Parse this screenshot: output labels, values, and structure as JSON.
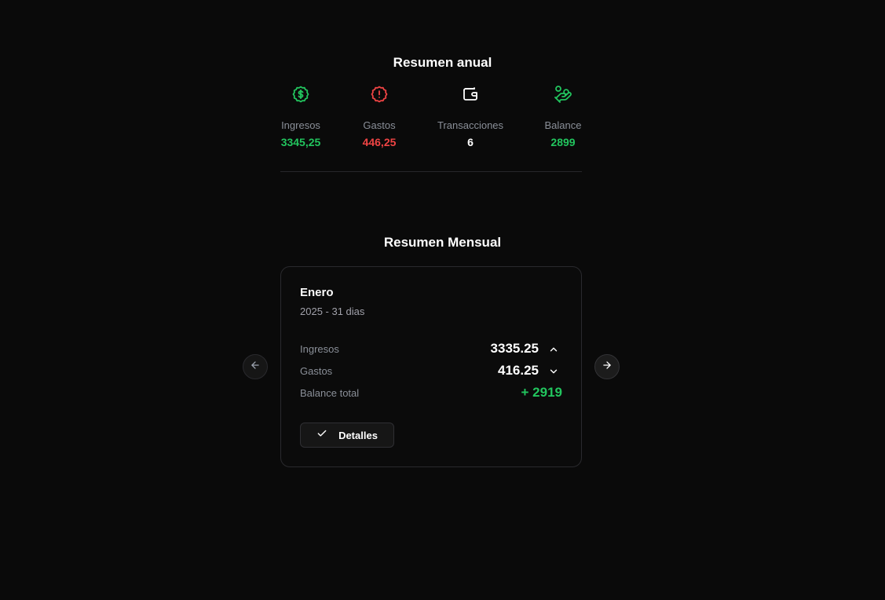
{
  "annual": {
    "title": "Resumen anual",
    "stats": [
      {
        "icon": "dollar-badge-icon",
        "label": "Ingresos",
        "value": "3345,25",
        "color": "#22c55e"
      },
      {
        "icon": "alert-badge-icon",
        "label": "Gastos",
        "value": "446,25",
        "color": "#ef4444"
      },
      {
        "icon": "wallet-icon",
        "label": "Transacciones",
        "value": "6",
        "color": "#ffffff"
      },
      {
        "icon": "hand-coins-icon",
        "label": "Balance",
        "value": "2899",
        "color": "#22c55e"
      }
    ]
  },
  "monthly": {
    "title": "Resumen Mensual",
    "card": {
      "month": "Enero",
      "subtitle": "2025 - 31 dias",
      "rows": [
        {
          "label": "Ingresos",
          "value": "3335.25",
          "icon": "chevron-up-icon"
        },
        {
          "label": "Gastos",
          "value": "416.25",
          "icon": "chevron-down-icon"
        },
        {
          "label": "Balance total",
          "value": "+ 2919",
          "color": "#22c55e"
        }
      ],
      "details_label": "Detalles",
      "details_icon": "check-icon"
    },
    "prev_icon": "arrow-left-icon",
    "next_icon": "arrow-right-icon"
  }
}
